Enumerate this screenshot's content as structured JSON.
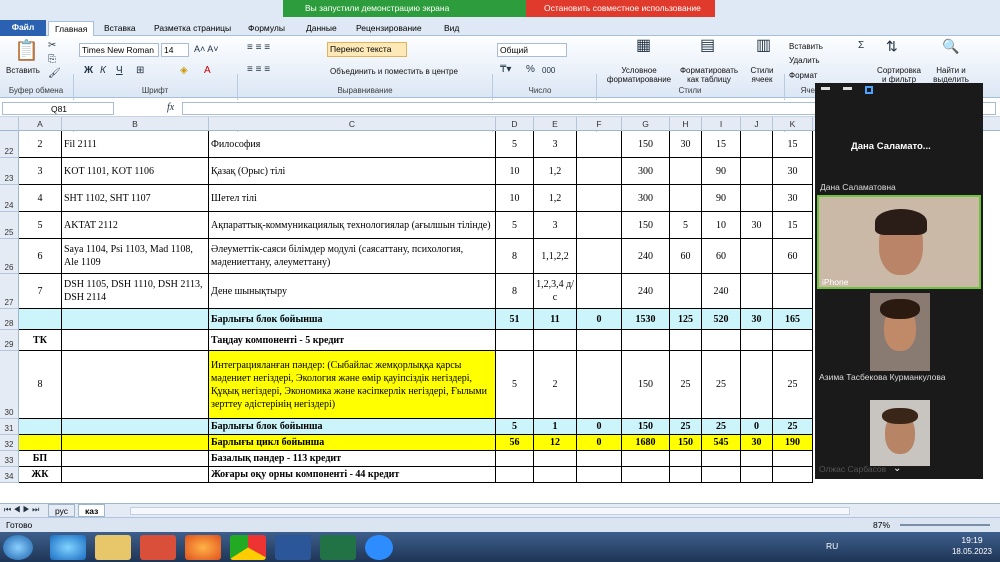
{
  "ribbon": {
    "file": "Файл",
    "tabs": [
      "Главная",
      "Вставка",
      "Разметка страницы",
      "Формулы",
      "Данные",
      "Рецензирование",
      "Вид"
    ],
    "paste": "Вставить",
    "font_name": "Times New Roman",
    "font_size": "14",
    "wrap": "Перенос текста",
    "merge": "Объединить и поместить в центре",
    "numformat": "Общий",
    "cond": "Условное форматирование",
    "table": "Форматировать как таблицу",
    "styles_btn": "Стили ячеек",
    "insert": "Вставить",
    "delete": "Удалить",
    "format": "Формат",
    "sort": "Сортировка и фильтр",
    "find": "Найти и выделить",
    "groups": [
      "Буфер обмена",
      "Шрифт",
      "Выравнивание",
      "Число",
      "Стили",
      "Ячей"
    ],
    "bold": "Ж",
    "italic": "К",
    "underline": "Ч",
    "pct": "%",
    "thousands": "000"
  },
  "banners": {
    "share": "Вы запустили демонстрацию экрана",
    "stop": "Остановить совместное использование"
  },
  "namebox": "Q81",
  "fx": "fx",
  "columns": [
    "A",
    "B",
    "C",
    "D",
    "E",
    "F",
    "G",
    "H",
    "I",
    "J",
    "K"
  ],
  "rows": [
    {
      "n": "22",
      "a": "2",
      "b": "Fil 2111",
      "c": "Философия",
      "d": "5",
      "e": "3",
      "f": "",
      "g": "150",
      "h": "30",
      "i": "15",
      "j": "",
      "k": "15"
    },
    {
      "n": "23",
      "a": "3",
      "b": "KOT 1101, KOT 1106",
      "c": "Қазақ (Орыс) тілі",
      "d": "10",
      "e": "1,2",
      "f": "",
      "g": "300",
      "h": "",
      "i": "90",
      "j": "",
      "k": "30"
    },
    {
      "n": "24",
      "a": "4",
      "b": "SHT 1102, SHT 1107",
      "c": "Шетел тілі",
      "d": "10",
      "e": "1,2",
      "f": "",
      "g": "300",
      "h": "",
      "i": "90",
      "j": "",
      "k": "30"
    },
    {
      "n": "25",
      "a": "5",
      "b": "AKTAT 2112",
      "c": "Ақпараттық-коммуникациялық технологиялар (ағылшын тілінде)",
      "d": "5",
      "e": "3",
      "f": "",
      "g": "150",
      "h": "5",
      "i": "10",
      "j": "30",
      "k": "15"
    },
    {
      "n": "26",
      "a": "6",
      "b": "Saya 1104, Psi 1103, Mad 1108, Ale 1109",
      "c": "Әлеуметтік-саяси білімдер модулі (саясаттану, психология, мәдениеттану, әлеуметтану)",
      "d": "8",
      "e": "1,1,2,2",
      "f": "",
      "g": "240",
      "h": "60",
      "i": "60",
      "j": "",
      "k": "60"
    },
    {
      "n": "27",
      "a": "7",
      "b": "DSH 1105, DSH 1110, DSH 2113, DSH 2114",
      "c": "Дене шынықтыру",
      "d": "8",
      "e": "1,2,3,4 д/с",
      "f": "",
      "g": "240",
      "h": "",
      "i": "240",
      "j": "",
      "k": ""
    },
    {
      "n": "28",
      "a": "",
      "b": "",
      "c": "Барлығы блок бойынша",
      "d": "51",
      "e": "11",
      "f": "0",
      "g": "1530",
      "h": "125",
      "i": "520",
      "j": "30",
      "k": "165"
    },
    {
      "n": "29",
      "a": "ТК",
      "b": "",
      "c": "Таңдау компоненті - 5 кредит",
      "d": "",
      "e": "",
      "f": "",
      "g": "",
      "h": "",
      "i": "",
      "j": "",
      "k": ""
    },
    {
      "n": "30",
      "a": "8",
      "b": "",
      "c": "Интеграцияланған пәндер: (Сыбайлас жемқорлыққа қарсы мәдениет негіздері, Экология және өмір қауіпсіздік негіздері,  Құқық негіздері, Экономика және кәсіпкерлік негіздері, Ғылыми зерттеу әдістерінің негіздері)",
      "d": "5",
      "e": "2",
      "f": "",
      "g": "150",
      "h": "25",
      "i": "25",
      "j": "",
      "k": "25"
    },
    {
      "n": "31",
      "a": "",
      "b": "",
      "c": "Барлығы блок бойынша",
      "d": "5",
      "e": "1",
      "f": "0",
      "g": "150",
      "h": "25",
      "i": "25",
      "j": "0",
      "k": "25"
    },
    {
      "n": "32",
      "a": "",
      "b": "",
      "c": "Барлығы цикл бойынша",
      "d": "56",
      "e": "12",
      "f": "0",
      "g": "1680",
      "h": "150",
      "i": "545",
      "j": "30",
      "k": "190"
    },
    {
      "n": "33",
      "a": "БП",
      "b": "",
      "c": "Базалық пәндер - 113 кредит",
      "d": "",
      "e": "",
      "f": "",
      "g": "",
      "h": "",
      "i": "",
      "j": "",
      "k": ""
    },
    {
      "n": "34",
      "a": "ЖК",
      "b": "",
      "c": "Жоғары оқу орны компоненті - 44 кредит",
      "d": "",
      "e": "",
      "f": "",
      "g": "",
      "h": "",
      "i": "",
      "j": "",
      "k": ""
    }
  ],
  "sheets": [
    "рус",
    "каз"
  ],
  "status": {
    "ready": "Готово",
    "zoom": "87%"
  },
  "zoom_panel": {
    "top_name": "Дана  Саламато...",
    "p1_label": "Дана Саламатовна",
    "p1_device": "iPhone",
    "p2_label": "Азима Тасбекова Курманкулова",
    "p3_label": "Олжас Сарбасов"
  },
  "tray": {
    "lang": "RU",
    "time": "19:19",
    "date": "18.05.2023"
  },
  "colors": {
    "cyan": "#ccf5fb",
    "yellow": "#ffff00",
    "green": "#2d9c3c",
    "red": "#e03a2c"
  }
}
